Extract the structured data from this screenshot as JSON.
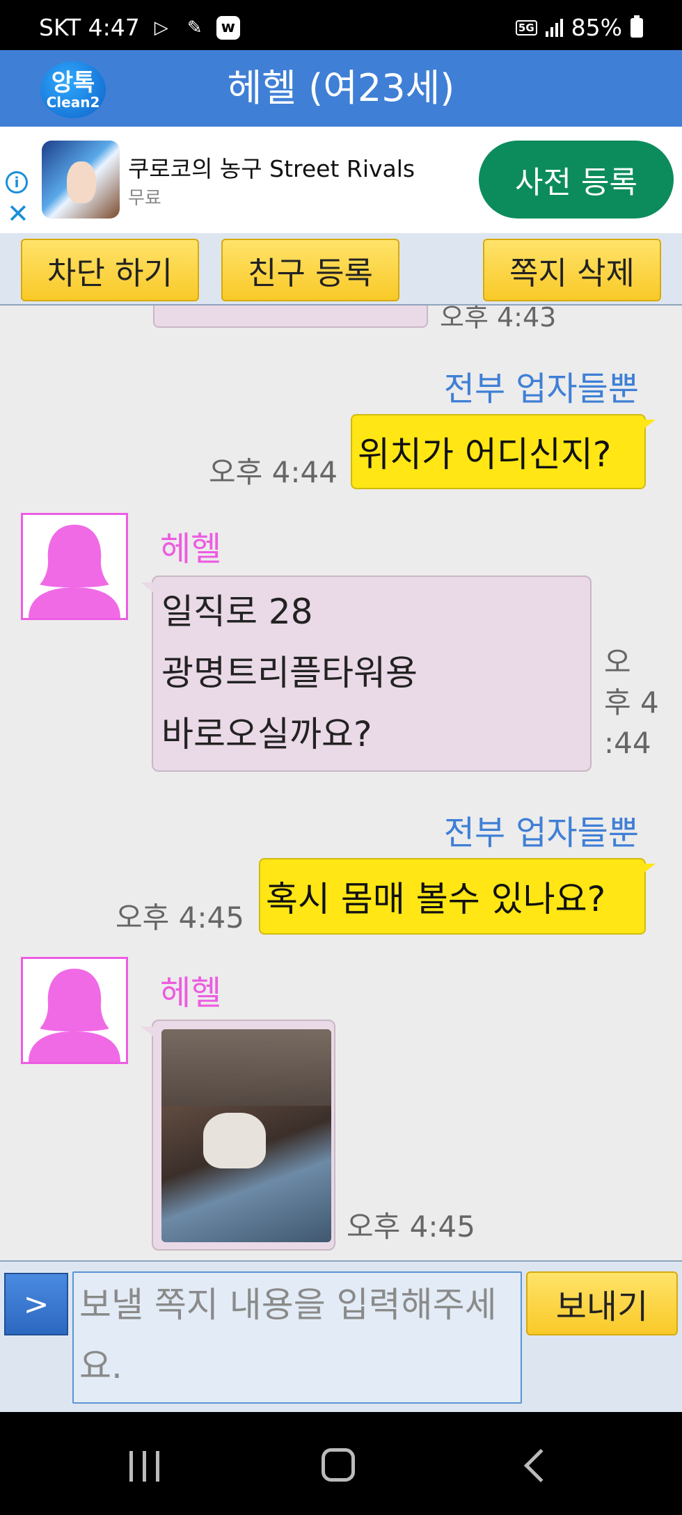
{
  "status_bar": {
    "carrier_time": "SKT 4:47",
    "network": "5G",
    "battery": "85%"
  },
  "header": {
    "logo_top": "앙톡",
    "logo_bottom": "Clean2",
    "title": "헤헬 (여23세)"
  },
  "ad": {
    "title": "쿠로코의 농구 Street Rivals",
    "subtitle": "무료",
    "cta": "사전 등록",
    "info_icon": "info-icon",
    "close_icon": "close-icon"
  },
  "actions": {
    "block": "차단 하기",
    "add_friend": "친구 등록",
    "delete": "쪽지 삭제"
  },
  "messages": {
    "prev_time": "오후 4:43",
    "m1": {
      "sender": "전부 업자들뿐",
      "text": "위치가 어디신지?",
      "time": "오후 4:44"
    },
    "m2": {
      "sender": "헤헬",
      "lines": [
        "일직로 28",
        "광명트리플타워용",
        "바로오실까요?"
      ],
      "time_lines": [
        "오",
        "후 4",
        ":44"
      ]
    },
    "m3": {
      "sender": "전부 업자들뿐",
      "text": "혹시 몸매 볼수 있나요?",
      "time": "오후 4:45"
    },
    "m4": {
      "sender": "헤헬",
      "time": "오후 4:45"
    }
  },
  "input": {
    "arrow": ">",
    "placeholder": "보낼 쪽지 내용을 입력해주세요.",
    "send": "보내기"
  },
  "colors": {
    "header": "#3f7fd6",
    "my_bubble": "#ffe614",
    "their_bubble": "#ead9e6",
    "their_name": "#ec5ce0",
    "my_name": "#3f7fd6",
    "ad_cta": "#0c8c5c"
  }
}
